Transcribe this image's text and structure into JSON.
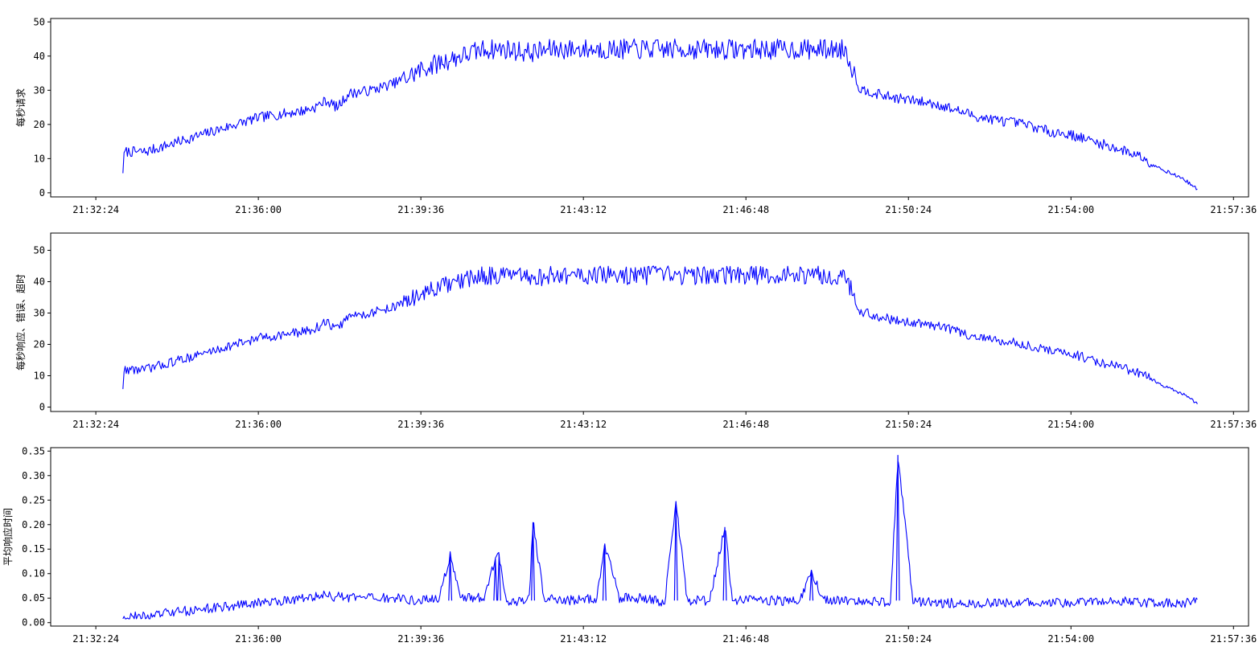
{
  "colors": {
    "line": "#0000ff",
    "axes": "#000000",
    "background": "#ffffff"
  },
  "chart_data": [
    {
      "type": "line",
      "ylabel": "每秒请求",
      "x_ticks": [
        "21:32:24",
        "21:36:00",
        "21:39:36",
        "21:43:12",
        "21:46:48",
        "21:50:24",
        "21:54:00",
        "21:57:36"
      ],
      "y_ticks": [
        "0",
        "10",
        "20",
        "30",
        "40",
        "50"
      ],
      "xlim": [
        "21:31:24",
        "21:57:56"
      ],
      "ylim": [
        -1.2,
        51
      ],
      "grid": false,
      "legend": "none",
      "series": [
        {
          "x": [
            "21:33:00",
            "21:33:02",
            "21:33:30",
            "21:34:00",
            "21:34:30",
            "21:35:00",
            "21:35:30",
            "21:36:00",
            "21:36:30",
            "21:37:00",
            "21:37:15",
            "21:37:30",
            "21:37:45",
            "21:38:00",
            "21:38:30",
            "21:39:00",
            "21:39:20",
            "21:39:36",
            "21:40:00",
            "21:40:30",
            "21:41:00",
            "21:41:30",
            "21:42:00",
            "21:42:30",
            "21:43:00",
            "21:43:30",
            "21:44:00",
            "21:44:30",
            "21:45:00",
            "21:45:30",
            "21:46:00",
            "21:46:30",
            "21:47:00",
            "21:47:30",
            "21:48:00",
            "21:48:30",
            "21:49:00",
            "21:49:20",
            "21:49:30",
            "21:49:40",
            "21:50:00",
            "21:50:30",
            "21:51:00",
            "21:51:30",
            "21:52:00",
            "21:52:30",
            "21:53:00",
            "21:53:30",
            "21:54:00",
            "21:54:30",
            "21:55:00",
            "21:55:30",
            "21:56:00",
            "21:56:30",
            "21:56:48"
          ],
          "values": [
            6,
            12,
            12,
            14,
            16,
            18,
            20,
            22,
            23,
            24,
            25,
            27,
            25,
            29,
            30,
            32,
            34,
            36,
            38,
            40,
            42,
            42,
            41,
            42,
            42,
            42,
            42,
            42,
            42,
            42,
            42,
            42,
            42,
            42,
            42,
            42,
            42,
            30,
            30,
            29,
            28,
            27,
            26,
            24,
            22,
            21,
            20,
            18,
            17,
            15,
            13,
            11,
            7,
            4,
            1
          ]
        }
      ]
    },
    {
      "type": "line",
      "ylabel": "每秒响应、错误、超时",
      "x_ticks": [
        "21:32:24",
        "21:36:00",
        "21:39:36",
        "21:43:12",
        "21:46:48",
        "21:50:24",
        "21:54:00",
        "21:57:36"
      ],
      "y_ticks": [
        "0",
        "10",
        "20",
        "30",
        "40",
        "50"
      ],
      "xlim": [
        "21:31:24",
        "21:57:56"
      ],
      "ylim": [
        -1.4,
        55.5
      ],
      "grid": false,
      "legend": "none",
      "series": [
        {
          "x": [
            "21:33:00",
            "21:33:02",
            "21:33:30",
            "21:34:00",
            "21:34:30",
            "21:35:00",
            "21:35:30",
            "21:36:00",
            "21:36:30",
            "21:37:00",
            "21:37:15",
            "21:37:30",
            "21:37:45",
            "21:38:00",
            "21:38:30",
            "21:39:00",
            "21:39:20",
            "21:39:36",
            "21:40:00",
            "21:40:30",
            "21:41:00",
            "21:41:30",
            "21:42:00",
            "21:42:30",
            "21:43:00",
            "21:43:30",
            "21:44:00",
            "21:44:30",
            "21:45:00",
            "21:45:30",
            "21:46:00",
            "21:46:30",
            "21:47:00",
            "21:47:30",
            "21:48:00",
            "21:48:30",
            "21:49:00",
            "21:49:20",
            "21:49:30",
            "21:49:40",
            "21:50:00",
            "21:50:30",
            "21:51:00",
            "21:51:30",
            "21:52:00",
            "21:52:30",
            "21:53:00",
            "21:53:30",
            "21:54:00",
            "21:54:30",
            "21:55:00",
            "21:55:30",
            "21:56:00",
            "21:56:30",
            "21:56:48"
          ],
          "values": [
            6,
            12,
            12,
            14,
            16,
            18,
            20,
            22,
            23,
            24,
            25,
            27,
            25,
            29,
            30,
            32,
            34,
            36,
            38,
            40,
            42,
            42,
            41,
            42,
            42,
            42,
            42,
            42,
            42,
            42,
            42,
            42,
            42,
            42,
            42,
            42,
            42,
            30,
            30,
            29,
            28,
            27,
            26,
            24,
            22,
            21,
            20,
            18,
            17,
            15,
            13,
            11,
            7,
            4,
            1
          ]
        }
      ]
    },
    {
      "type": "line",
      "ylabel": "平均响应时间",
      "x_ticks": [
        "21:32:24",
        "21:36:00",
        "21:39:36",
        "21:43:12",
        "21:46:48",
        "21:50:24",
        "21:54:00",
        "21:57:36"
      ],
      "y_ticks": [
        "0.00",
        "0.05",
        "0.10",
        "0.15",
        "0.20",
        "0.25",
        "0.30",
        "0.35"
      ],
      "xlim": [
        "21:31:24",
        "21:57:56"
      ],
      "ylim": [
        -0.007,
        0.357
      ],
      "grid": false,
      "legend": "none",
      "series": [
        {
          "x": [
            "21:33:00",
            "21:33:30",
            "21:34:00",
            "21:34:30",
            "21:35:00",
            "21:35:30",
            "21:36:00",
            "21:36:30",
            "21:37:00",
            "21:37:30",
            "21:38:00",
            "21:38:30",
            "21:39:00",
            "21:39:30",
            "21:40:00",
            "21:40:15",
            "21:40:30",
            "21:41:00",
            "21:41:15",
            "21:41:20",
            "21:41:30",
            "21:42:00",
            "21:42:05",
            "21:42:20",
            "21:42:30",
            "21:43:00",
            "21:43:30",
            "21:43:40",
            "21:44:00",
            "21:44:30",
            "21:45:00",
            "21:45:15",
            "21:45:30",
            "21:46:00",
            "21:46:20",
            "21:46:30",
            "21:47:00",
            "21:47:30",
            "21:48:00",
            "21:48:15",
            "21:48:30",
            "21:49:00",
            "21:49:30",
            "21:50:00",
            "21:50:10",
            "21:50:30",
            "21:51:00",
            "21:51:30",
            "21:52:00",
            "21:52:30",
            "21:53:00",
            "21:53:30",
            "21:54:00",
            "21:54:30",
            "21:55:00",
            "21:55:30",
            "21:56:00",
            "21:56:30",
            "21:56:48"
          ],
          "values": [
            0.012,
            0.012,
            0.02,
            0.025,
            0.03,
            0.035,
            0.04,
            0.045,
            0.05,
            0.055,
            0.05,
            0.05,
            0.05,
            0.045,
            0.05,
            0.135,
            0.05,
            0.05,
            0.13,
            0.14,
            0.04,
            0.05,
            0.205,
            0.045,
            0.05,
            0.045,
            0.05,
            0.158,
            0.05,
            0.05,
            0.04,
            0.247,
            0.045,
            0.045,
            0.195,
            0.045,
            0.045,
            0.045,
            0.045,
            0.107,
            0.045,
            0.045,
            0.045,
            0.04,
            0.342,
            0.045,
            0.04,
            0.04,
            0.04,
            0.04,
            0.04,
            0.04,
            0.04,
            0.045,
            0.045,
            0.04,
            0.04,
            0.04,
            0.05
          ]
        }
      ]
    }
  ]
}
